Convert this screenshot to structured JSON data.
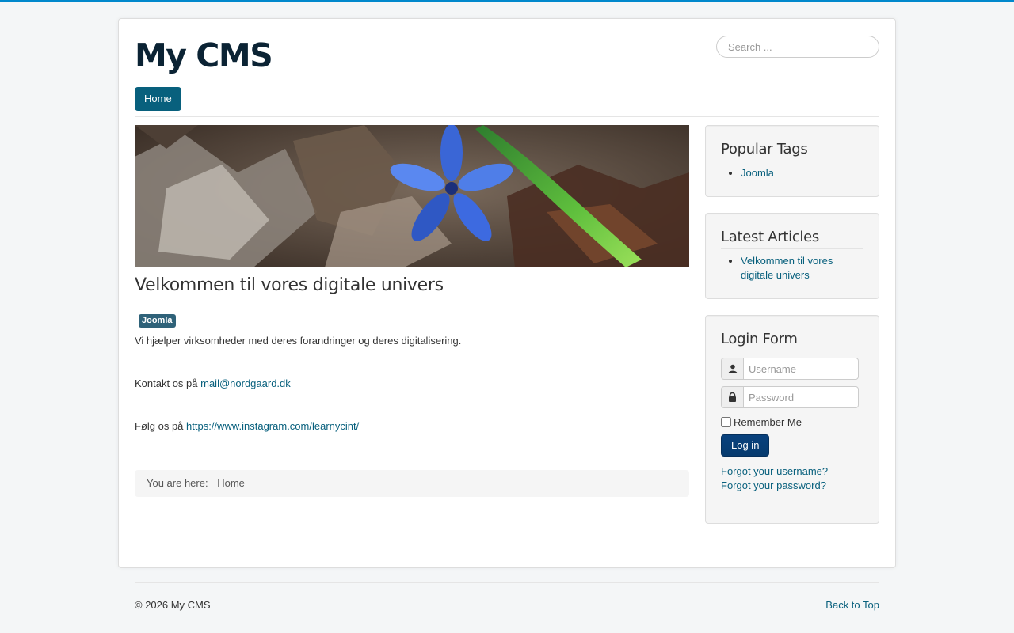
{
  "header": {
    "brand": "My CMS",
    "search_placeholder": "Search ..."
  },
  "nav": {
    "home_label": "Home"
  },
  "article": {
    "title": "Velkommen til vores digitale univers",
    "tag": "Joomla",
    "intro": "Vi hjælper virksomheder med deres forandringer og deres digitalisering.",
    "contact_prefix": "Kontakt os på ",
    "contact_email": "mail@nordgaard.dk",
    "follow_prefix": "Følg os på ",
    "follow_url": "https://www.instagram.com/learnycint/"
  },
  "breadcrumb": {
    "label": "You are here:",
    "current": "Home"
  },
  "sidebar": {
    "popular_tags": {
      "title": "Popular Tags",
      "items": [
        "Joomla"
      ]
    },
    "latest_articles": {
      "title": "Latest Articles",
      "items": [
        "Velkommen til vores digitale univers"
      ]
    },
    "login": {
      "title": "Login Form",
      "username_placeholder": "Username",
      "password_placeholder": "Password",
      "remember_label": "Remember Me",
      "login_button": "Log in",
      "forgot_username": "Forgot your username?",
      "forgot_password": "Forgot your password?"
    }
  },
  "footer": {
    "copyright": "© 2026 My CMS",
    "back_to_top": "Back to Top"
  },
  "colors": {
    "accent": "#0088cc",
    "link": "#08607d",
    "nav_active": "#08607d",
    "button": "#08417d"
  },
  "icons": {
    "username": "user-icon",
    "password": "lock-icon"
  }
}
